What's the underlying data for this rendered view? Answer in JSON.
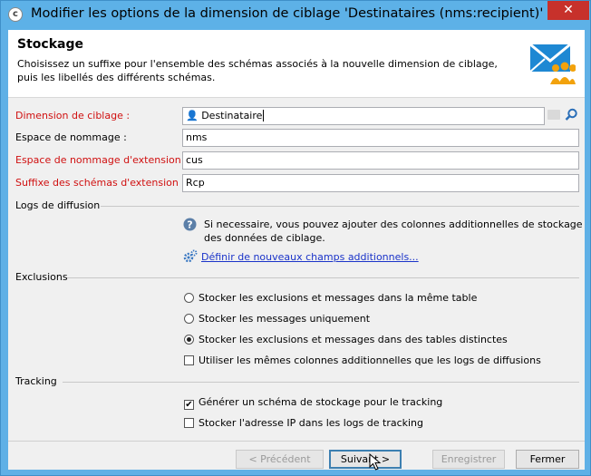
{
  "window": {
    "title": "Modifier les options de la dimension de ciblage 'Destinataires (nms:recipient)'",
    "close": "✕"
  },
  "header": {
    "title": "Stockage",
    "description": "Choisissez un suffixe pour l'ensemble des schémas associés à la nouvelle dimension de ciblage, puis les libellés des différents schémas."
  },
  "form": {
    "targeting_label": "Dimension de ciblage :",
    "targeting_value": "Destinataire",
    "namespace_label": "Espace de nommage :",
    "namespace_value": "nms",
    "ext_namespace_label": "Espace de nommage d'extension :",
    "ext_namespace_value": "cus",
    "suffix_label": "Suffixe des schémas d'extension :",
    "suffix_value": "Rcp"
  },
  "delivery_logs": {
    "section": "Logs de diffusion",
    "info": "Si necessaire, vous pouvez ajouter des colonnes additionnelles de stockage des données de ciblage.",
    "link": "Définir de nouveaux champs additionnels..."
  },
  "exclusions": {
    "section": "Exclusions",
    "options": [
      "Stocker les exclusions et messages dans la même table",
      "Stocker les messages uniquement",
      "Stocker les exclusions et messages dans des tables distinctes"
    ],
    "selected_index": 2,
    "same_columns": "Utiliser les mêmes colonnes additionnelles que les logs de diffusions"
  },
  "tracking": {
    "section": "Tracking",
    "generate": "Générer un schéma de stockage pour le tracking",
    "store_ip": "Stocker l'adresse IP dans les logs de tracking"
  },
  "buttons": {
    "previous": "< Précédent",
    "next": "Suivant >",
    "save": "Enregistrer",
    "close": "Fermer"
  }
}
